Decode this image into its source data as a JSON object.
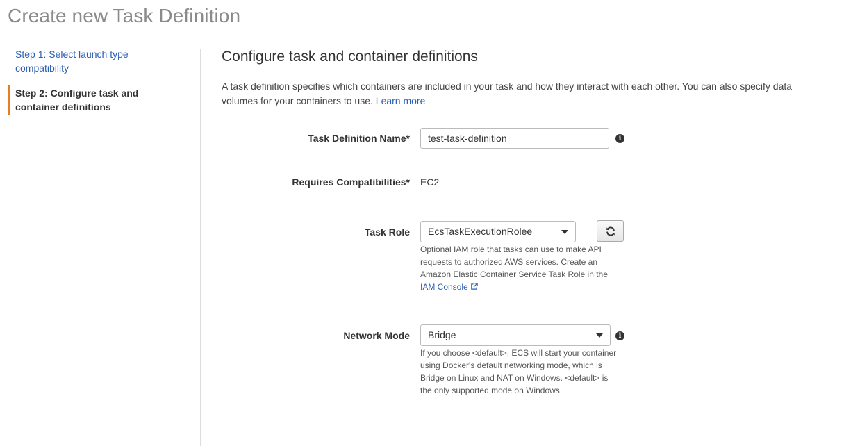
{
  "page": {
    "title": "Create new Task Definition"
  },
  "steps": [
    {
      "label": "Step 1: Select launch type compatibility",
      "state": "link"
    },
    {
      "label": "Step 2: Configure task and container definitions",
      "state": "active"
    }
  ],
  "section": {
    "title": "Configure task and container definitions",
    "description": "A task definition specifies which containers are included in your task and how they interact with each other. You can also specify data volumes for your containers to use.",
    "learn_more": "Learn more"
  },
  "form": {
    "task_name": {
      "label": "Task Definition Name*",
      "value": "test-task-definition"
    },
    "compat": {
      "label": "Requires Compatibilities*",
      "value": "EC2"
    },
    "task_role": {
      "label": "Task Role",
      "value": "EcsTaskExecutionRolee",
      "help": "Optional IAM role that tasks can use to make API requests to authorized AWS services. Create an Amazon Elastic Container Service Task Role in the",
      "help_link": "IAM Console"
    },
    "network_mode": {
      "label": "Network Mode",
      "value": "Bridge",
      "help": "If you choose <default>, ECS will start your container using Docker's default networking mode, which is Bridge on Linux and NAT on Windows. <default> is the only supported mode on Windows."
    }
  },
  "icons": {
    "info": "info-icon",
    "refresh": "refresh-icon",
    "external_link": "external-link-icon",
    "dropdown": "chevron-down-icon"
  },
  "colors": {
    "link": "#2c5fb5",
    "active_step_accent": "#e67e22",
    "title_gray": "#8a8a8a"
  }
}
